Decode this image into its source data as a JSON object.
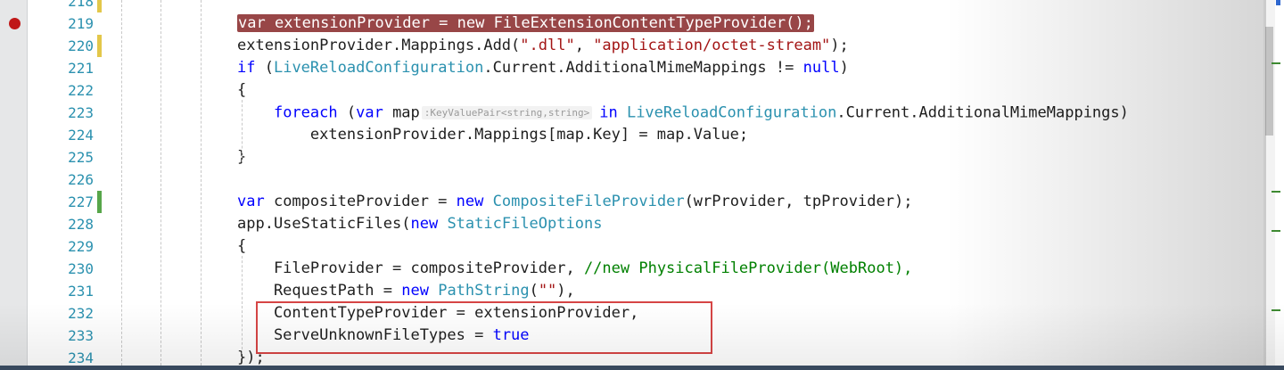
{
  "lines": [
    {
      "number": "218",
      "change": "yellow",
      "breakpoint": false,
      "tokens": []
    },
    {
      "number": "219",
      "change": "",
      "breakpoint": true,
      "highlight": true,
      "tokens": [
        {
          "c": "kw",
          "t": "var"
        },
        {
          "c": "plain",
          "t": " extensionProvider = "
        },
        {
          "c": "kw",
          "t": "new"
        },
        {
          "c": "plain",
          "t": " "
        },
        {
          "c": "type",
          "t": "FileExtensionContentTypeProvider"
        },
        {
          "c": "plain",
          "t": "();"
        }
      ]
    },
    {
      "number": "220",
      "change": "yellow",
      "breakpoint": false,
      "tokens": [
        {
          "c": "plain",
          "t": "extensionProvider.Mappings.Add("
        },
        {
          "c": "str",
          "t": "\".dll\""
        },
        {
          "c": "plain",
          "t": ", "
        },
        {
          "c": "str",
          "t": "\"application/octet-stream\""
        },
        {
          "c": "plain",
          "t": ");"
        }
      ]
    },
    {
      "number": "221",
      "change": "",
      "breakpoint": false,
      "tokens": [
        {
          "c": "kw",
          "t": "if"
        },
        {
          "c": "plain",
          "t": " ("
        },
        {
          "c": "type",
          "t": "LiveReloadConfiguration"
        },
        {
          "c": "plain",
          "t": ".Current.AdditionalMimeMappings != "
        },
        {
          "c": "kw",
          "t": "null"
        },
        {
          "c": "plain",
          "t": ")"
        }
      ]
    },
    {
      "number": "222",
      "change": "",
      "breakpoint": false,
      "tokens": [
        {
          "c": "plain",
          "t": "{"
        }
      ]
    },
    {
      "number": "223",
      "change": "",
      "breakpoint": false,
      "tokens": [
        {
          "c": "plain",
          "t": "    "
        },
        {
          "c": "kw",
          "t": "foreach"
        },
        {
          "c": "plain",
          "t": " ("
        },
        {
          "c": "kw",
          "t": "var"
        },
        {
          "c": "plain",
          "t": " "
        },
        {
          "c": "dots",
          "t": "map"
        },
        {
          "c": "hint",
          "t": ":KeyValuePair<string,string>"
        },
        {
          "c": "kw",
          "t": "in"
        },
        {
          "c": "plain",
          "t": " "
        },
        {
          "c": "type",
          "t": "LiveReloadConfiguration"
        },
        {
          "c": "plain",
          "t": ".Current.AdditionalMimeMappings)"
        }
      ]
    },
    {
      "number": "224",
      "change": "",
      "breakpoint": false,
      "tokens": [
        {
          "c": "plain",
          "t": "        extensionProvider.Mappings[map.Key] = map.Value;"
        }
      ]
    },
    {
      "number": "225",
      "change": "",
      "breakpoint": false,
      "tokens": [
        {
          "c": "plain",
          "t": "}"
        }
      ]
    },
    {
      "number": "226",
      "change": "",
      "breakpoint": false,
      "tokens": []
    },
    {
      "number": "227",
      "change": "green",
      "breakpoint": false,
      "tokens": [
        {
          "c": "kw",
          "t": "var"
        },
        {
          "c": "plain",
          "t": " compositeProvider = "
        },
        {
          "c": "kw",
          "t": "new"
        },
        {
          "c": "plain",
          "t": " "
        },
        {
          "c": "type",
          "t": "CompositeFileProvider"
        },
        {
          "c": "plain",
          "t": "(wrProvider, tpProvider);"
        }
      ]
    },
    {
      "number": "228",
      "change": "",
      "breakpoint": false,
      "tokens": [
        {
          "c": "plain",
          "t": "app.UseStaticFiles("
        },
        {
          "c": "kw",
          "t": "new"
        },
        {
          "c": "plain",
          "t": " "
        },
        {
          "c": "type",
          "t": "StaticFileOptions"
        }
      ]
    },
    {
      "number": "229",
      "change": "",
      "breakpoint": false,
      "tokens": [
        {
          "c": "plain",
          "t": "{"
        }
      ]
    },
    {
      "number": "230",
      "change": "",
      "breakpoint": false,
      "tokens": [
        {
          "c": "plain",
          "t": "    FileProvider = compositeProvider, "
        },
        {
          "c": "cmt",
          "t": "//new PhysicalFileProvider(WebRoot),"
        }
      ]
    },
    {
      "number": "231",
      "change": "",
      "breakpoint": false,
      "tokens": [
        {
          "c": "plain",
          "t": "    RequestPath = "
        },
        {
          "c": "kw",
          "t": "new"
        },
        {
          "c": "plain",
          "t": " "
        },
        {
          "c": "type",
          "t": "PathString"
        },
        {
          "c": "plain",
          "t": "("
        },
        {
          "c": "str",
          "t": "\"\""
        },
        {
          "c": "plain",
          "t": "),"
        }
      ]
    },
    {
      "number": "232",
      "change": "",
      "breakpoint": false,
      "tokens": [
        {
          "c": "plain",
          "t": "    ContentTypeProvider = extensionProvider,"
        }
      ]
    },
    {
      "number": "233",
      "change": "",
      "breakpoint": false,
      "tokens": [
        {
          "c": "plain",
          "t": "    ServeUnknownFileTypes = "
        },
        {
          "c": "kw",
          "t": "true"
        }
      ]
    },
    {
      "number": "234",
      "change": "",
      "breakpoint": false,
      "tokens": [
        {
          "c": "plain",
          "t": "});"
        }
      ]
    }
  ],
  "colors": {
    "keyword": "#0000ff",
    "type": "#2b91af",
    "string": "#a31515",
    "comment": "#008000",
    "line_number": "#2b91af",
    "breakpoint": "#c01818",
    "breakpoint_highlight": "#984647",
    "change_saved": "#57a64a",
    "change_unsaved": "#e3c74a",
    "callout_box": "#d64545"
  }
}
